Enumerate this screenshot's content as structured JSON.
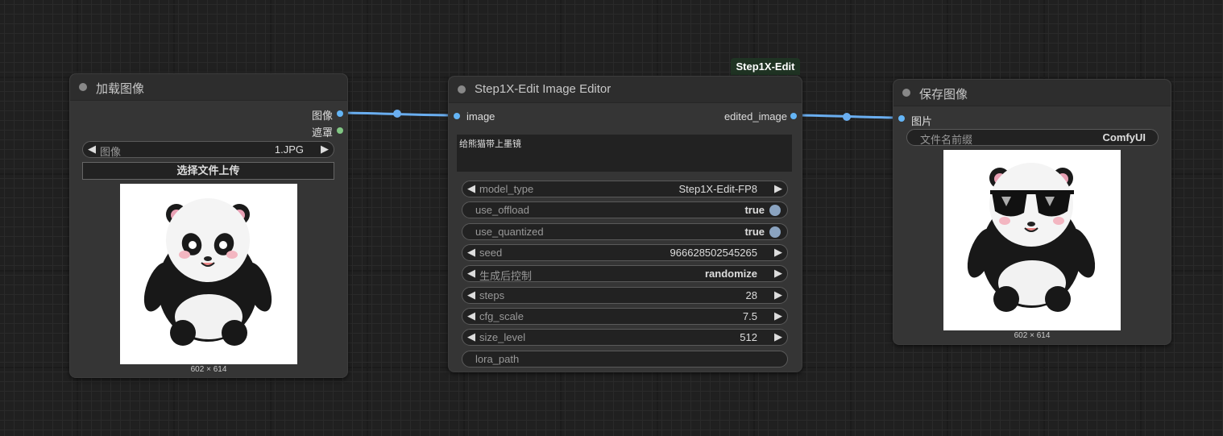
{
  "group_badge": "Step1X-Edit",
  "load_node": {
    "title": "加载图像",
    "outputs": [
      "图像",
      "遮罩"
    ],
    "image_widget": {
      "label": "图像",
      "value": "1.JPG"
    },
    "upload_button": "选择文件上传",
    "image_dims": "602 × 614"
  },
  "editor_node": {
    "title": "Step1X-Edit Image Editor",
    "input": "image",
    "output": "edited_image",
    "prompt": "给熊猫带上墨镜",
    "widgets": [
      {
        "label": "model_type",
        "value": "Step1X-Edit-FP8"
      },
      {
        "label": "use_offload",
        "value": "true"
      },
      {
        "label": "use_quantized",
        "value": "true"
      },
      {
        "label": "seed",
        "value": "966628502545265"
      },
      {
        "label": "生成后控制",
        "value": "randomize"
      },
      {
        "label": "steps",
        "value": "28"
      },
      {
        "label": "cfg_scale",
        "value": "7.5"
      },
      {
        "label": "size_level",
        "value": "512"
      },
      {
        "label": "lora_path",
        "value": ""
      }
    ]
  },
  "save_node": {
    "title": "保存图像",
    "input": "图片",
    "prefix_widget": {
      "label": "文件名前缀",
      "value": "ComfyUI"
    },
    "image_dims": "602 × 614"
  },
  "colors": {
    "link": "#6aaef0",
    "image_slot": "#64b5f6",
    "mask_slot": "#81c784",
    "toggle": "#8aa3c0"
  },
  "icons": [
    "node-collapse-dot",
    "arrow-left-icon",
    "arrow-right-icon",
    "toggle-knob",
    "panda-image",
    "panda-sunglasses-image"
  ]
}
